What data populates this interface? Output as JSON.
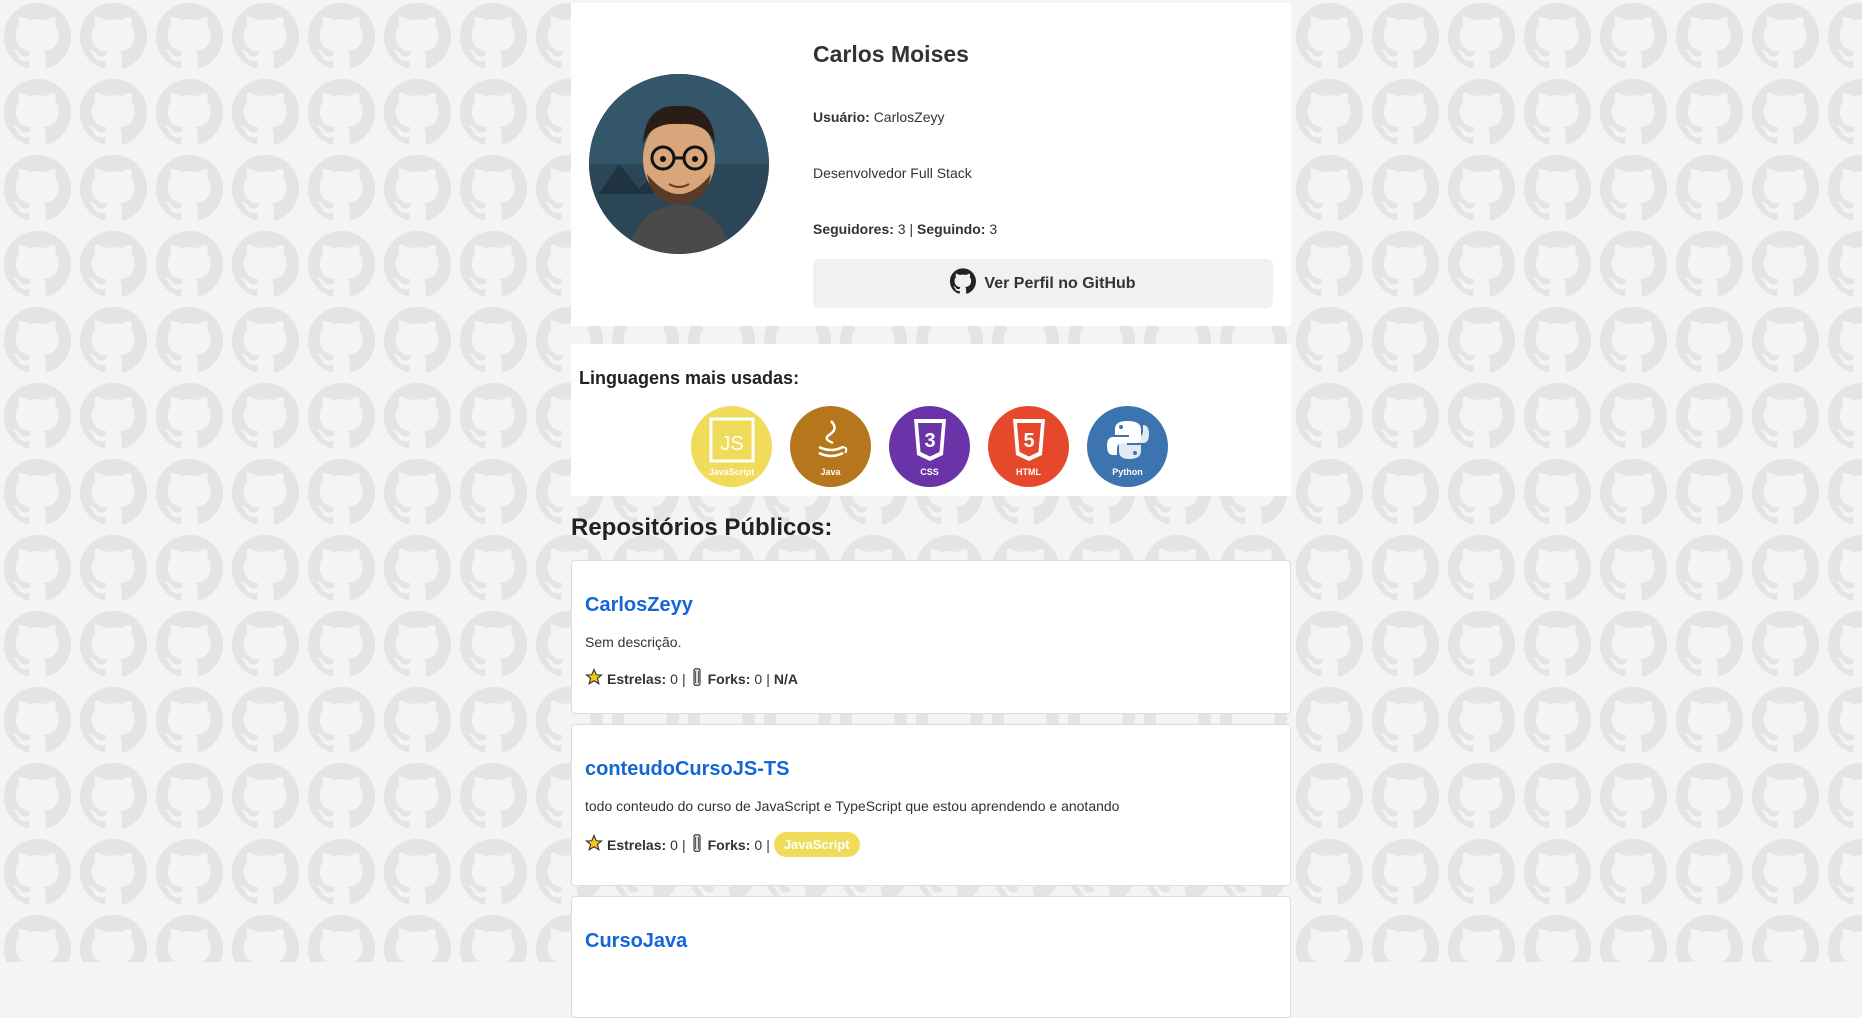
{
  "profile": {
    "name": "Carlos Moises",
    "user_label": "Usuário:",
    "user_value": "CarlosZeyy",
    "bio": "Desenvolvedor Full Stack",
    "followers_label": "Seguidores:",
    "followers_value": "3",
    "separator": "|",
    "following_label": "Seguindo:",
    "following_value": "3",
    "github_button": "Ver Perfil no GitHub"
  },
  "languages": {
    "title": "Linguagens mais usadas:",
    "items": [
      {
        "label": "JavaScript",
        "color": "#f0dc5a",
        "icon": "javascript-icon"
      },
      {
        "label": "Java",
        "color": "#b5761c",
        "icon": "java-icon"
      },
      {
        "label": "CSS",
        "color": "#6a34a8",
        "icon": "css3-icon"
      },
      {
        "label": "HTML",
        "color": "#e5482a",
        "icon": "html5-icon"
      },
      {
        "label": "Python",
        "color": "#3b74ae",
        "icon": "python-icon"
      }
    ]
  },
  "repos": {
    "title": "Repositórios Públicos:",
    "stars_label": "Estrelas:",
    "forks_label": "Forks:",
    "items": [
      {
        "name": "CarlosZeyy",
        "desc": "Sem descrição.",
        "stars": "0",
        "forks": "0",
        "lang": "N/A"
      },
      {
        "name": "conteudoCursoJS-TS",
        "desc": "todo conteudo do curso de JavaScript e TypeScript que estou aprendendo e anotando",
        "stars": "0",
        "forks": "0",
        "lang": "JavaScript"
      },
      {
        "name": "CursoJava"
      }
    ]
  }
}
